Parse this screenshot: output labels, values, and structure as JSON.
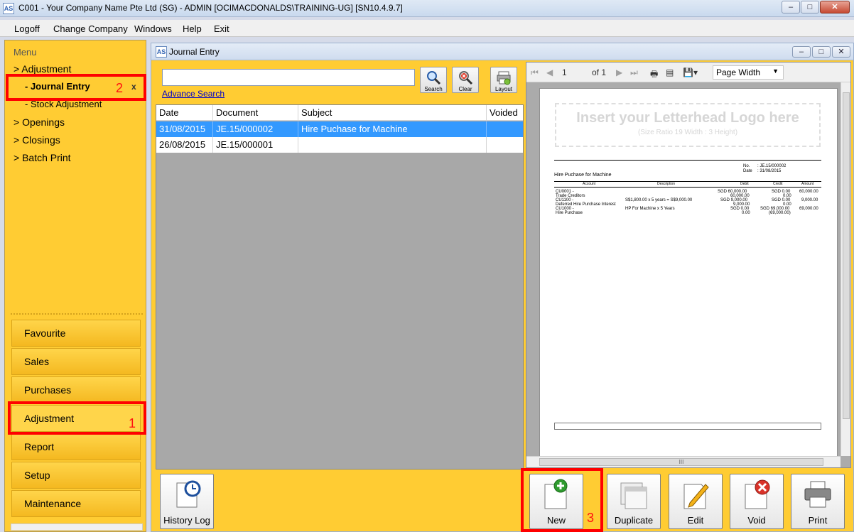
{
  "window": {
    "title": "C001 - Your Company Name Pte Ltd (SG) - ADMIN [OCIMACDONALDS\\TRAINING-UG] [SN10.4.9.7]",
    "icon_text": "AS",
    "minimize": "–",
    "maximize": "□",
    "close": "✕"
  },
  "menubar": {
    "items": [
      "Logoff",
      "Change Company",
      "Windows",
      "Help",
      "Exit"
    ]
  },
  "sidebar": {
    "title": "Menu",
    "tree": [
      {
        "label": "> Adjustment"
      },
      {
        "label": "- Journal Entry"
      },
      {
        "label": "- Stock Adjustment"
      },
      {
        "label": "> Openings"
      },
      {
        "label": "> Closings"
      },
      {
        "label": "> Batch Print"
      }
    ],
    "close_tab": "x",
    "modules": [
      "Favourite",
      "Sales",
      "Purchases",
      "Adjustment",
      "Report",
      "Setup",
      "Maintenance"
    ]
  },
  "annotations": {
    "a1": "1",
    "a2": "2",
    "a3": "3",
    "color": "#ff0000"
  },
  "journal": {
    "title": "Journal Entry",
    "search_value": "",
    "advance_search": "Advance Search",
    "tools": {
      "search": "Search",
      "clear": "Clear",
      "layout": "Layout"
    },
    "columns": [
      "Date",
      "Document",
      "Subject",
      "Voided"
    ],
    "rows": [
      {
        "date": "31/08/2015",
        "document": "JE.15/000002",
        "subject": "Hire Puchase for Machine",
        "voided": ""
      },
      {
        "date": "26/08/2015",
        "document": "JE.15/000001",
        "subject": "",
        "voided": ""
      }
    ]
  },
  "preview": {
    "page_current": "1",
    "page_of": "of 1",
    "zoom": "Page Width",
    "logo_text": "Insert your Letterhead Logo here",
    "logo_hint": "(Size Ratio 19 Width : 3 Height)",
    "no_label": "No.",
    "no_value": ": JE.15/000002",
    "date_label": "Date",
    "date_value": ": 31/08/2015",
    "subject": "Hire Puchase for Machine",
    "table_headers": [
      "Account",
      "Description",
      "Debit",
      "Credit",
      "Amount"
    ],
    "lines": {
      "acc": [
        "CU0001 -",
        "Trade Creditors",
        "CU1100 -",
        "Deferred Hire Purchase Interest",
        "CU1000 -",
        "Hire Purchase"
      ],
      "desc": [
        "",
        "",
        "S$1,800.00 x 5 years = S$9,000.00",
        "",
        "HP For Machine x 5 Years",
        ""
      ],
      "debit": [
        "SGD 60,000.00",
        "60,000.00",
        "SGD 9,000.00",
        "9,000.00",
        "SGD 0.00",
        "0.00"
      ],
      "credit": [
        "SGD 0.00",
        "0.00",
        "SGD 0.00",
        "0.00",
        "SGD 69,000.00",
        "(69,000.00)"
      ],
      "amount": [
        "60,000.00",
        "",
        "9,000.00",
        "",
        "69,000.00",
        ""
      ]
    },
    "hscroll_grip": "III"
  },
  "actions": {
    "history_log": "History Log",
    "new": "New",
    "duplicate": "Duplicate",
    "edit": "Edit",
    "void": "Void",
    "print": "Print"
  }
}
